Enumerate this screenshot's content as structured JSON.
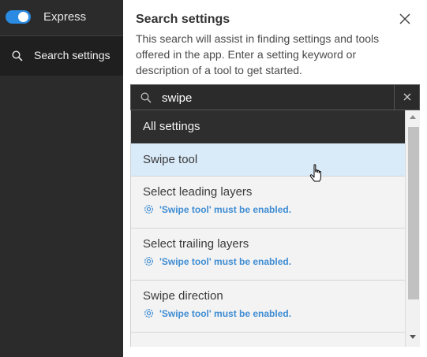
{
  "sidebar": {
    "express_label": "Express",
    "express_toggle_on": true,
    "search_item_label": "Search settings",
    "search_icon": "search-icon"
  },
  "panel": {
    "title": "Search settings",
    "description": "This search will assist in finding settings and tools offered in the app. Enter a setting keyword or description of a tool to get started.",
    "close_icon": "close-icon"
  },
  "search": {
    "value": "swipe",
    "placeholder": "",
    "clear_icon": "close-icon"
  },
  "results": {
    "header": "All settings",
    "items": [
      {
        "name": "Swipe tool",
        "note": ""
      },
      {
        "name": "Select leading layers",
        "note": "'Swipe tool' must be enabled."
      },
      {
        "name": "Select trailing layers",
        "note": "'Swipe tool' must be enabled."
      },
      {
        "name": "Swipe direction",
        "note": "'Swipe tool' must be enabled."
      }
    ]
  },
  "colors": {
    "accent": "#2b8be2",
    "note_text": "#3f8dd3",
    "hover_row": "#d9eaf8",
    "sidebar_bg": "#2b2b2b"
  }
}
